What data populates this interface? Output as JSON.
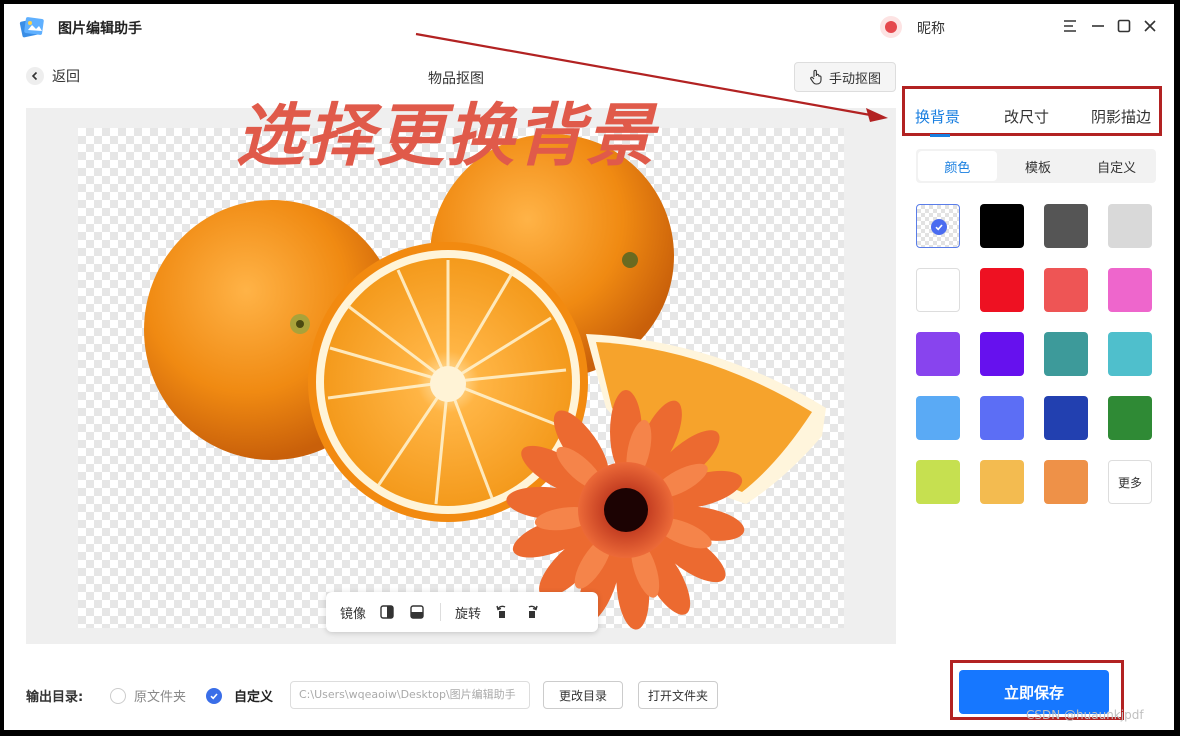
{
  "app": {
    "title": "图片编辑助手",
    "nickname": "昵称"
  },
  "nav": {
    "back_label": "返回",
    "page_title": "物品抠图",
    "manual_cutout_label": "手动抠图"
  },
  "annotation": {
    "text": "选择更换背景"
  },
  "tabs": [
    {
      "label": "换背景",
      "active": true
    },
    {
      "label": "改尺寸",
      "active": false
    },
    {
      "label": "阴影描边",
      "active": false
    }
  ],
  "subtabs": [
    {
      "label": "颜色",
      "active": true
    },
    {
      "label": "模板",
      "active": false
    },
    {
      "label": "自定义",
      "active": false
    }
  ],
  "swatches": [
    {
      "name": "transparent",
      "color": "transparent",
      "selected": true
    },
    {
      "name": "black",
      "color": "#000000"
    },
    {
      "name": "dark-gray",
      "color": "#555555"
    },
    {
      "name": "light-gray",
      "color": "#d9d9d9"
    },
    {
      "name": "white",
      "color": "#ffffff"
    },
    {
      "name": "red",
      "color": "#ee1122"
    },
    {
      "name": "coral",
      "color": "#ee5555"
    },
    {
      "name": "pink",
      "color": "#ee66cc"
    },
    {
      "name": "violet",
      "color": "#8844ee"
    },
    {
      "name": "purple",
      "color": "#6611ee"
    },
    {
      "name": "teal",
      "color": "#3d9a9a"
    },
    {
      "name": "cyan",
      "color": "#4fbfcc"
    },
    {
      "name": "sky-blue",
      "color": "#5aaaf5"
    },
    {
      "name": "periwinkle",
      "color": "#5c6ef5"
    },
    {
      "name": "navy",
      "color": "#2240b0"
    },
    {
      "name": "green",
      "color": "#2f8a35"
    },
    {
      "name": "lime",
      "color": "#c6e050"
    },
    {
      "name": "gold",
      "color": "#f3bb50"
    },
    {
      "name": "orange",
      "color": "#ee9148"
    }
  ],
  "more_label": "更多",
  "toolbar": {
    "mirror_label": "镜像",
    "rotate_label": "旋转"
  },
  "output": {
    "label": "输出目录:",
    "option_original": "原文件夹",
    "option_custom": "自定义",
    "path": "C:\\Users\\wqeaoiw\\Desktop\\图片编辑助手",
    "change_dir_label": "更改目录",
    "open_folder_label": "打开文件夹"
  },
  "save_label": "立即保存",
  "watermark": "CSDN @huaunkjpdf",
  "colors": {
    "accent": "#1677ff",
    "annotation": "#e05a4a",
    "highlight_box": "#b22222"
  }
}
